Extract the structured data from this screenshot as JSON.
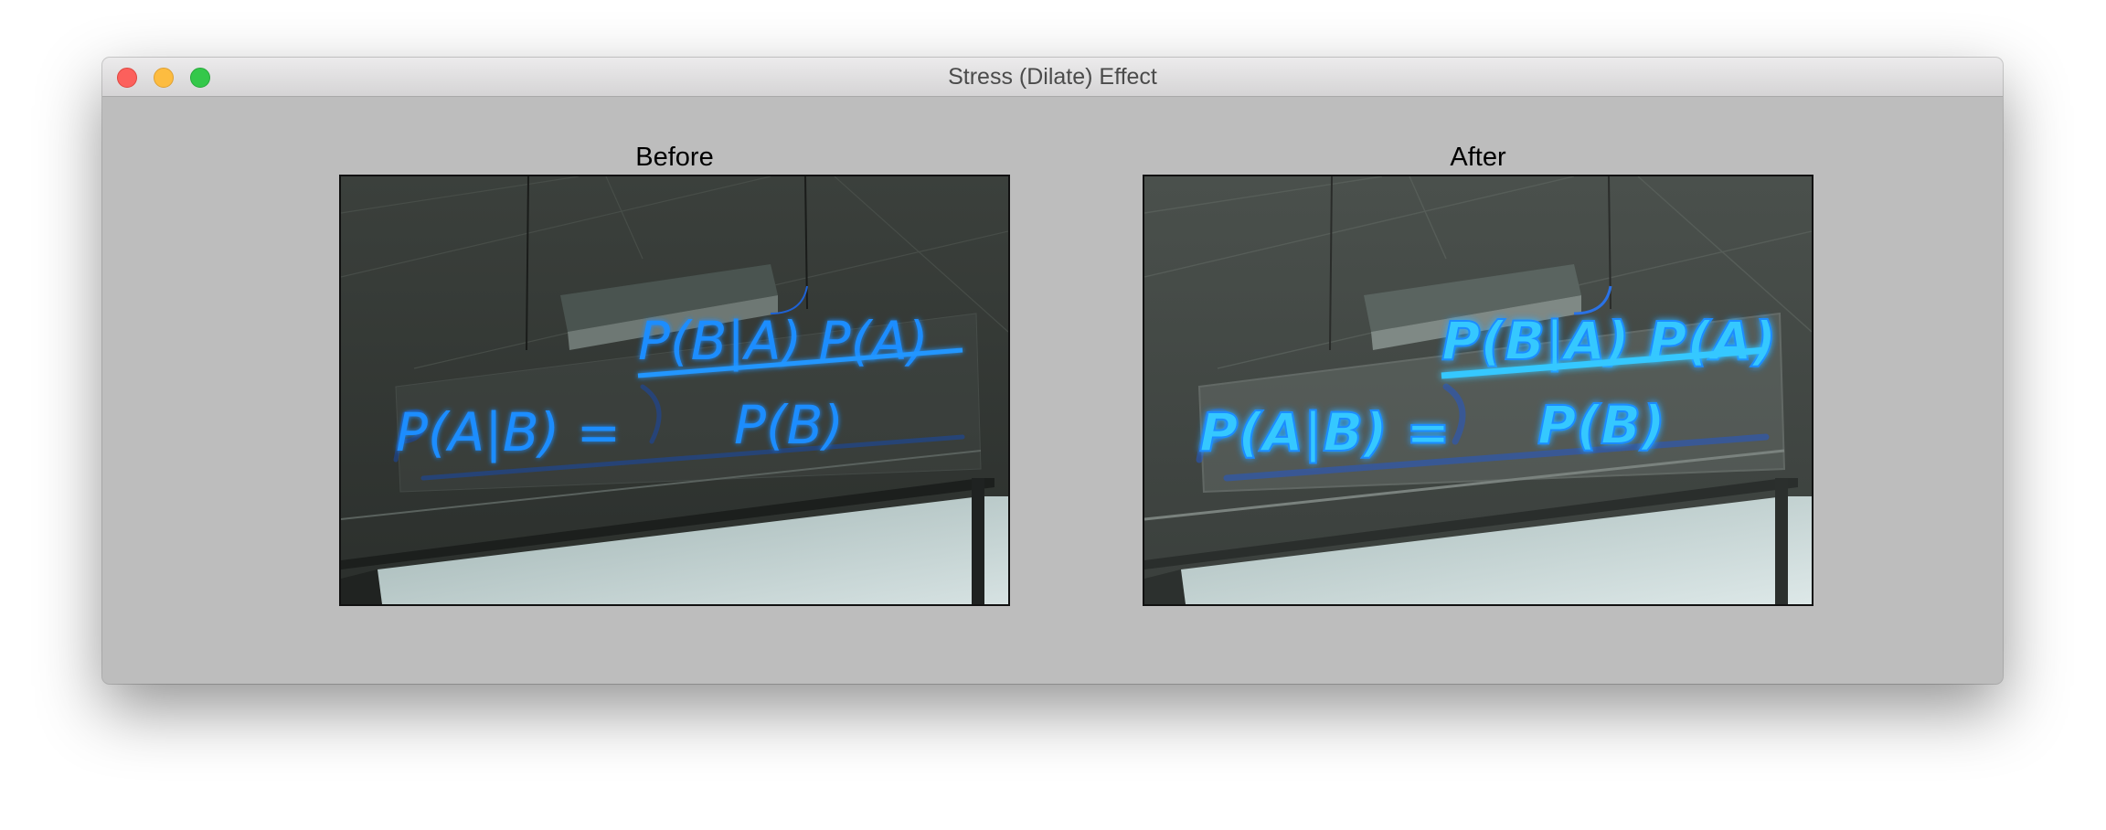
{
  "window": {
    "title": "Stress (Dilate) Effect"
  },
  "panels": {
    "before": {
      "label": "Before",
      "image_icon": "neon-bayes-theorem-photo-original"
    },
    "after": {
      "label": "After",
      "image_icon": "neon-bayes-theorem-photo-dilated"
    }
  },
  "image_text": {
    "lhs": "P(A|B) =",
    "numerator": "P(B|A) P(A)",
    "denominator": "P(B)"
  },
  "colors": {
    "neon": "#1e90ff",
    "neon_bright": "#33d2ff",
    "window_bg": "#bdbdbd",
    "close": "#fc605c",
    "minimize": "#fdbc40",
    "zoom": "#34c84a"
  }
}
